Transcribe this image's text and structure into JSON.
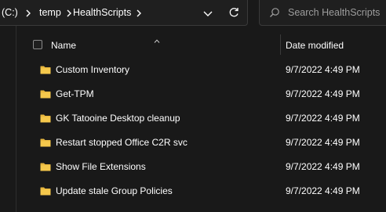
{
  "breadcrumb": {
    "items": [
      "(C:)",
      "temp",
      "HealthScripts"
    ]
  },
  "search": {
    "placeholder": "Search HealthScripts"
  },
  "columns": {
    "name": "Name",
    "date_modified": "Date modified"
  },
  "files": [
    {
      "name": "Custom Inventory",
      "date_modified": "9/7/2022 4:49 PM",
      "type": "folder"
    },
    {
      "name": "Get-TPM",
      "date_modified": "9/7/2022 4:49 PM",
      "type": "folder"
    },
    {
      "name": "GK Tatooine Desktop cleanup",
      "date_modified": "9/7/2022 4:49 PM",
      "type": "folder"
    },
    {
      "name": "Restart stopped Office C2R svc",
      "date_modified": "9/7/2022 4:49 PM",
      "type": "folder"
    },
    {
      "name": "Show File Extensions",
      "date_modified": "9/7/2022 4:49 PM",
      "type": "folder"
    },
    {
      "name": "Update stale Group Policies",
      "date_modified": "9/7/2022 4:49 PM",
      "type": "folder"
    }
  ],
  "icons": {
    "folder": "folder-icon",
    "chevron": "chevron-right-icon",
    "dropdown": "chevron-down-icon",
    "refresh": "refresh-icon",
    "search": "search-icon"
  },
  "colors": {
    "background": "#191919",
    "folder": "#e8b73e",
    "text": "#ffffff",
    "placeholder": "#9d9d9d"
  }
}
